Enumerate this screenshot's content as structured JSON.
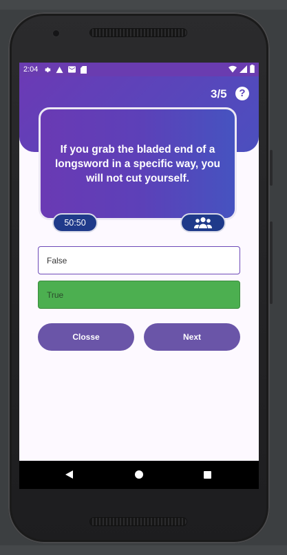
{
  "status_bar": {
    "time": "2:04",
    "icons": [
      "gear-icon",
      "warning-icon",
      "mail-icon",
      "sd-card-icon"
    ],
    "right_icons": [
      "wifi-icon",
      "signal-icon",
      "battery-icon"
    ]
  },
  "header": {
    "progress": "3/5",
    "help_label": "?"
  },
  "question": {
    "text": "If you grab the bladed end of a longsword in a specific way, you will not cut yourself."
  },
  "lifelines": {
    "fifty_fifty_label": "50:50",
    "audience_icon": "audience-icon"
  },
  "answers": [
    {
      "label": "False",
      "state": "default"
    },
    {
      "label": "True",
      "state": "correct"
    }
  ],
  "actions": {
    "close_label": "Closse",
    "next_label": "Next"
  },
  "colors": {
    "primary": "#6b3ab5",
    "correct": "#4caf50",
    "button": "#6a55a8",
    "lifeline": "#1f3a8a"
  }
}
